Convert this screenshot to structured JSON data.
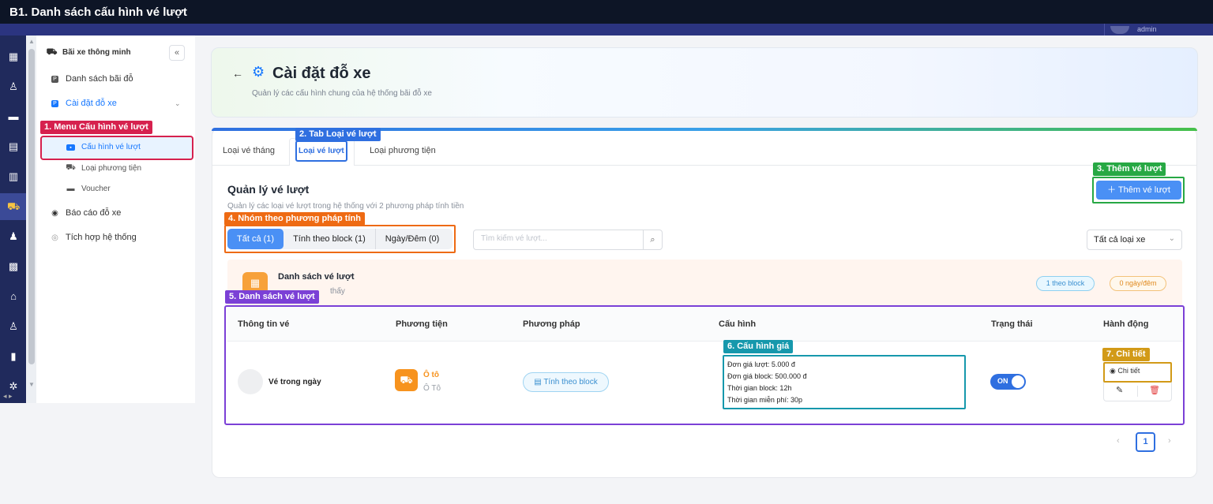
{
  "window_title": "B1. Danh sách cấu hình vé lượt",
  "user": {
    "name": "admin"
  },
  "sidebar": {
    "group_label": "Bãi xe thông minh",
    "collapse_icon": "«",
    "items": [
      {
        "label": "Danh sách bãi đỗ"
      },
      {
        "label": "Cài đặt đỗ xe"
      },
      {
        "label": "Cấu hình vé lượt"
      },
      {
        "label": "Loại phương tiện"
      },
      {
        "label": "Voucher"
      },
      {
        "label": "Báo cáo đỗ xe"
      },
      {
        "label": "Tích hợp hệ thống"
      }
    ]
  },
  "rail_icons": [
    "building-icon",
    "user-person-icon",
    "chat-icon",
    "calculator-icon",
    "briefcase-icon",
    "car-icon",
    "users-icon",
    "apartment-icon",
    "store-icon",
    "account-icon",
    "chart-icon",
    "settings-icon"
  ],
  "header": {
    "title": "Cài đặt đỗ xe",
    "subtitle": "Quản lý các cấu hình chung của hệ thống bãi đỗ xe"
  },
  "tabs": [
    {
      "label": "Loại vé tháng"
    },
    {
      "label": "Loại vé lượt"
    },
    {
      "label": "Loại phương tiện"
    }
  ],
  "section": {
    "title": "Quản lý vé lượt",
    "subtitle": "Quản lý các loại vé lượt trong hệ thống với 2 phương pháp tính tiền",
    "add_button": "Thêm vé lượt"
  },
  "filters": {
    "segments": [
      "Tất cả (1)",
      "Tính theo block (1)",
      "Ngày/Đêm (0)"
    ],
    "search_placeholder": "Tìm kiếm vé lượt...",
    "vehicle_select": "Tất cả loại xe"
  },
  "banner": {
    "title": "Danh sách vé lượt",
    "subtitle": "thấy",
    "pill_block": "1 theo block",
    "pill_day": "0 ngày/đêm"
  },
  "table": {
    "headers": [
      "Thông tin vé",
      "Phương tiện",
      "Phương pháp",
      "Cấu hình",
      "Trạng thái",
      "Hành động"
    ],
    "rows": [
      {
        "name": "Vé trong ngày",
        "vehicle": "Ô tô",
        "vehicle_sub": "Ô Tô",
        "method": "Tính theo block",
        "config": [
          "Đơn giá lượt: 5.000 đ",
          "Đơn giá block: 500.000 đ",
          "Thời gian block: 12h",
          "Thời gian miễn phí: 30p"
        ],
        "status": "ON",
        "detail_label": "Chi tiết"
      }
    ]
  },
  "pagination": {
    "current": "1"
  },
  "callouts": {
    "c1": "1. Menu Cấu hình vé lượt",
    "c2": "2. Tab Loại vé lượt",
    "c3": "3. Thêm vé lượt",
    "c4": "4. Nhóm theo phương pháp tính",
    "c5": "5. Danh sách vé lượt",
    "c6": "6. Cấu hình giá",
    "c7": "7. Chi tiết"
  },
  "colors": {
    "accent": "#2f6fe0",
    "rail": "#202a5c",
    "titlebar": "#0d1526",
    "orange": "#f7931e"
  }
}
